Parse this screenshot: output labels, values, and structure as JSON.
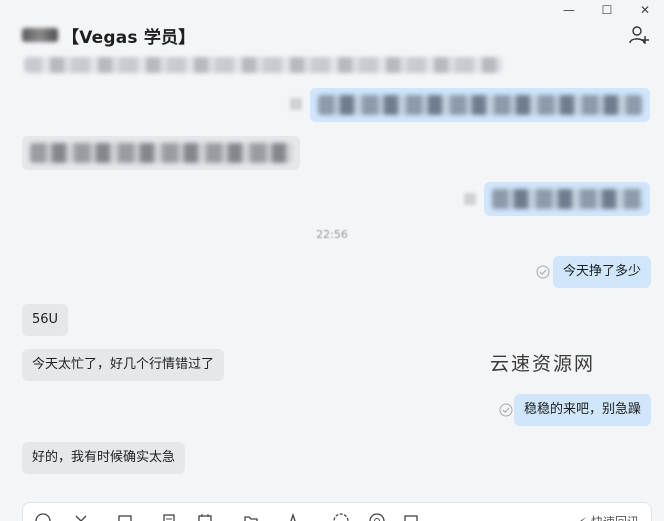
{
  "window": {
    "controls": [
      {
        "name": "minimize-button",
        "glyph": "—"
      },
      {
        "name": "maximize-button",
        "glyph": "☐"
      },
      {
        "name": "close-button",
        "glyph": "✕"
      }
    ]
  },
  "header": {
    "title": "【Vegas 学员】",
    "add_member_icon": "add-user-icon"
  },
  "chat": {
    "time_separator": "22:56",
    "messages": [
      {
        "side": "out",
        "text": "今天挣了多少",
        "status": "read-check-icon"
      },
      {
        "side": "in",
        "text": "56U"
      },
      {
        "side": "in",
        "text": "今天太忙了，好几个行情错过了"
      },
      {
        "side": "out",
        "text": "稳稳的来吧，别急躁",
        "status": "read-check-icon"
      },
      {
        "side": "in",
        "text": "好的，我有时候确实太急"
      }
    ]
  },
  "watermark": "云速资源网",
  "input_bar": {
    "quick_reply_label": "快速回讯",
    "tools": [
      "emoji-icon",
      "scissors-icon",
      "folder-icon",
      "document-icon",
      "calendar-icon",
      "file-icon",
      "pen-icon",
      "history-icon",
      "mention-icon",
      "image-icon"
    ]
  },
  "colors": {
    "incoming_bubble": "#e6e7ea",
    "outgoing_bubble": "#cfe6fb",
    "background": "#f4f5f7"
  }
}
